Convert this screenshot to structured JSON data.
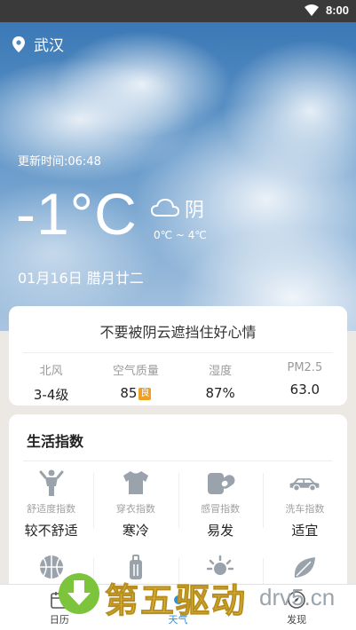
{
  "status_bar": {
    "time": "8:00"
  },
  "location": {
    "city": "武汉"
  },
  "weather": {
    "update_time": "更新时间:06:48",
    "temperature": "-1°C",
    "condition": "阴",
    "range": "0℃ ~ 4℃",
    "date": "01月16日 腊月廿二"
  },
  "summary": {
    "slogan": "不要被阴云遮挡住好心情",
    "stats": [
      {
        "label": "北风",
        "value": "3-4级"
      },
      {
        "label": "空气质量",
        "value": "85",
        "badge": "良"
      },
      {
        "label": "湿度",
        "value": "87%"
      },
      {
        "label": "PM2.5",
        "value": "63.0"
      }
    ]
  },
  "life_index": {
    "title": "生活指数",
    "items": [
      {
        "label": "舒适度指数",
        "value": "较不舒适",
        "icon": "person-icon"
      },
      {
        "label": "穿衣指数",
        "value": "寒冷",
        "icon": "shirt-icon"
      },
      {
        "label": "感冒指数",
        "value": "易发",
        "icon": "pill-icon"
      },
      {
        "label": "洗车指数",
        "value": "适宜",
        "icon": "car-icon"
      }
    ],
    "row2_icons": [
      "basketball-icon",
      "luggage-icon",
      "sun-icon",
      "leaf-icon"
    ]
  },
  "tabs": [
    {
      "label": "日历",
      "icon": "calendar-icon"
    },
    {
      "label": "天气",
      "icon": "weather-icon",
      "active": true
    },
    {
      "label": "发现",
      "icon": "compass-icon"
    }
  ],
  "watermark": {
    "text_cn": "第五驱动",
    "text_en": "drv5.cn"
  },
  "colors": {
    "accent": "#2e90e0",
    "sky_top": "#3a78b6",
    "badge": "#f0a020",
    "watermark": "#e8c24a"
  }
}
